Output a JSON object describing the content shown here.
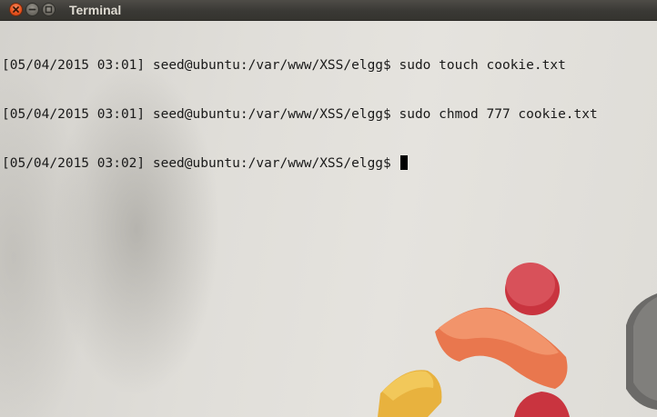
{
  "window": {
    "title": "Terminal",
    "buttons": {
      "close_icon": "close-icon",
      "minimize_icon": "minimize-icon",
      "maximize_icon": "maximize-icon",
      "close_color": "#e9531f"
    }
  },
  "terminal": {
    "background": "#e3e1dc",
    "text_color": "#1a1a1a",
    "lines": [
      "[05/04/2015 03:01] seed@ubuntu:/var/www/XSS/elgg$ sudo touch cookie.txt",
      "[05/04/2015 03:01] seed@ubuntu:/var/www/XSS/elgg$ sudo chmod 777 cookie.txt",
      "[05/04/2015 03:02] seed@ubuntu:/var/www/XSS/elgg$ "
    ],
    "cursor_visible": true
  }
}
